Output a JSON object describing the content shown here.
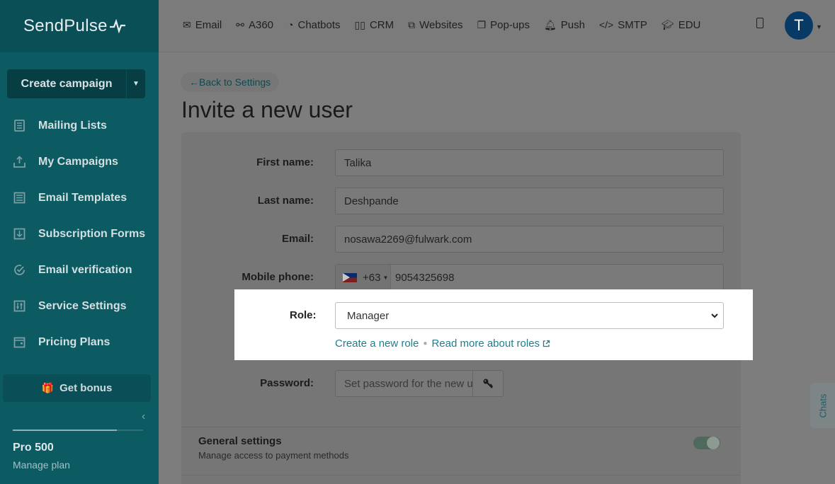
{
  "brand": {
    "name": "SendPulse"
  },
  "sidebar": {
    "create_campaign": "Create campaign",
    "items": [
      {
        "label": "Mailing Lists",
        "icon": "address-book-icon"
      },
      {
        "label": "My Campaigns",
        "icon": "send-tray-icon"
      },
      {
        "label": "Email Templates",
        "icon": "template-icon"
      },
      {
        "label": "Subscription Forms",
        "icon": "form-icon"
      },
      {
        "label": "Email verification",
        "icon": "check-circle-icon"
      },
      {
        "label": "Service Settings",
        "icon": "settings-sliders-icon"
      },
      {
        "label": "Pricing Plans",
        "icon": "wallet-icon"
      }
    ],
    "bonus": "Get bonus",
    "plan_name": "Pro 500",
    "plan_link": "Manage plan",
    "plan_usage_fraction": 0.8
  },
  "topnav": [
    {
      "label": "Email",
      "icon": "envelope-icon"
    },
    {
      "label": "A360",
      "icon": "flow-icon"
    },
    {
      "label": "Chatbots",
      "icon": "chat-bubble-icon"
    },
    {
      "label": "CRM",
      "icon": "kanban-icon"
    },
    {
      "label": "Websites",
      "icon": "cursor-window-icon"
    },
    {
      "label": "Pop-ups",
      "icon": "popup-icon"
    },
    {
      "label": "Push",
      "icon": "bell-icon"
    },
    {
      "label": "SMTP",
      "icon": "code-icon"
    },
    {
      "label": "EDU",
      "icon": "graduation-cap-icon"
    }
  ],
  "user": {
    "initial": "T"
  },
  "page": {
    "back": "←Back to Settings",
    "title": "Invite a new user"
  },
  "form": {
    "first_name": {
      "label": "First name:",
      "value": "Talika"
    },
    "last_name": {
      "label": "Last name:",
      "value": "Deshpande"
    },
    "email": {
      "label": "Email:",
      "value": "nosawa2269@fulwark.com"
    },
    "phone": {
      "label": "Mobile phone:",
      "code": "+63",
      "value": "9054325698",
      "country": "PH"
    },
    "role": {
      "label": "Role:",
      "value": "Manager",
      "create_link": "Create a new role",
      "read_link": "Read more about roles"
    },
    "password": {
      "label": "Password:",
      "placeholder": "Set password for the new user"
    }
  },
  "general": {
    "title": "General settings",
    "subtitle": "Manage access to payment methods",
    "enabled": true
  },
  "chats": "Chats",
  "colors": {
    "sidebar": "#0c5a62",
    "accent": "#1d7e8e",
    "avatar": "#083a66"
  }
}
